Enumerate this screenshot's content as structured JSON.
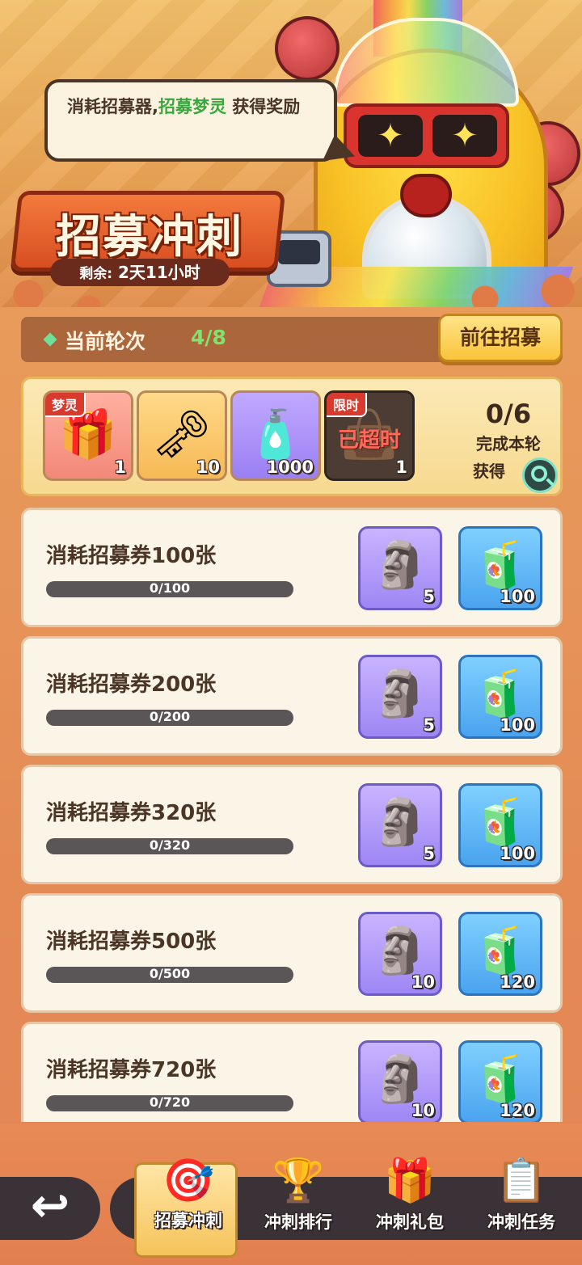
{
  "banner": {
    "bubble_text_1": "消耗招募器,",
    "bubble_text_highlight": "招募梦灵",
    "bubble_text_2": " 获得奖励",
    "title": "招募冲刺",
    "remain_label": "剩余:",
    "remain_value": "2天11小时"
  },
  "round": {
    "label": "当前轮次",
    "value": "4/8",
    "goto_button": "前往招募"
  },
  "reward_panel": {
    "slots": [
      {
        "tag": "梦灵",
        "icon": "mystery-chest-icon",
        "count": "1"
      },
      {
        "tag": "",
        "icon": "star-key-icon",
        "count": "10"
      },
      {
        "tag": "",
        "icon": "rainbow-bottle-icon",
        "count": "1000"
      },
      {
        "tag": "限时",
        "icon": "gift-bag-icon",
        "count": "1",
        "status": "已超时"
      }
    ],
    "progress": "0/6",
    "progress_label": "完成本轮",
    "obtain_label": "获得"
  },
  "tasks": [
    {
      "title": "消耗招募券100张",
      "progress_text": "0/100",
      "progress": 0,
      "rewards": [
        {
          "icon": "spirit-statue-icon",
          "count": "5"
        },
        {
          "icon": "potion-bottle-icon",
          "count": "100"
        }
      ]
    },
    {
      "title": "消耗招募券200张",
      "progress_text": "0/200",
      "progress": 0,
      "rewards": [
        {
          "icon": "spirit-statue-icon",
          "count": "5"
        },
        {
          "icon": "potion-bottle-icon",
          "count": "100"
        }
      ]
    },
    {
      "title": "消耗招募券320张",
      "progress_text": "0/320",
      "progress": 0,
      "rewards": [
        {
          "icon": "spirit-statue-icon",
          "count": "5"
        },
        {
          "icon": "potion-bottle-icon",
          "count": "100"
        }
      ]
    },
    {
      "title": "消耗招募券500张",
      "progress_text": "0/500",
      "progress": 0,
      "rewards": [
        {
          "icon": "spirit-statue-icon",
          "count": "10"
        },
        {
          "icon": "potion-bottle-icon",
          "count": "120"
        }
      ]
    },
    {
      "title": "消耗招募券720张",
      "progress_text": "0/720",
      "progress": 0,
      "rewards": [
        {
          "icon": "spirit-statue-icon",
          "count": "10"
        },
        {
          "icon": "potion-bottle-icon",
          "count": "120"
        }
      ]
    }
  ],
  "nav": {
    "tabs": [
      {
        "label": "招募冲刺",
        "icon": "dartboard-icon",
        "active": true
      },
      {
        "label": "冲刺排行",
        "icon": "trophy-icon",
        "active": false
      },
      {
        "label": "冲刺礼包",
        "icon": "gift-box-icon",
        "active": false
      },
      {
        "label": "冲刺任务",
        "icon": "clipboard-icon",
        "active": false
      }
    ]
  },
  "colors": {
    "accent_green": "#3aa63f",
    "round_green": "#7fe36d",
    "expired_red": "#ff6a5a",
    "button_gold": "#f9c43b"
  }
}
